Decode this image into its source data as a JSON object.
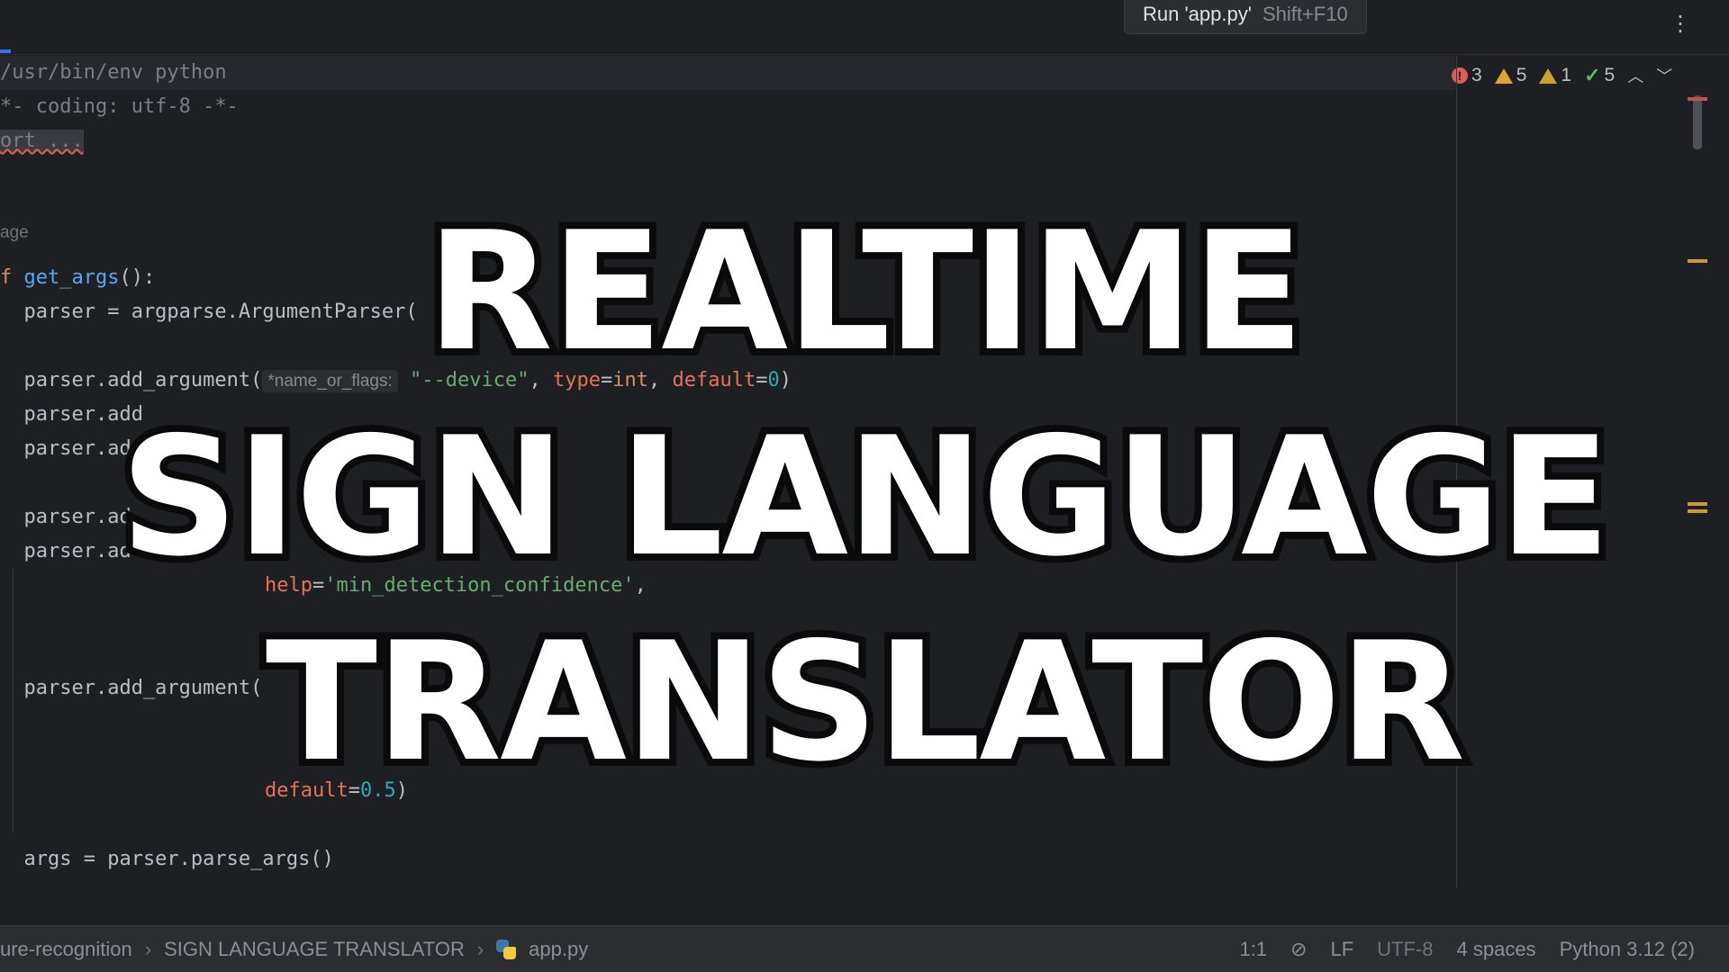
{
  "tooltip": {
    "label": "Run 'app.py'",
    "shortcut": "Shift+F10"
  },
  "inspections": {
    "errors": "3",
    "warnings": "5",
    "weak_warnings": "1",
    "ok": "5"
  },
  "editor": {
    "lines": {
      "shebang": "/usr/bin/env python",
      "coding": "*- coding: utf-8 -*-",
      "import_fold": "ort ...",
      "usage": "age",
      "def_prefix": "f ",
      "def_name": "get_args",
      "def_suffix": "():",
      "parser_line": "  parser = argparse.ArgumentParser(",
      "add_arg_device_pre": "  parser.add_argument(",
      "hint_name_or_flags": "*name_or_flags:",
      "device_str": "\"--device\"",
      "comma1": ", ",
      "type_kw": "type",
      "eq1": "=",
      "int_kw": "int",
      "comma2": ", ",
      "default_kw": "default",
      "eq2": "=",
      "zero": "0",
      "close": ")",
      "add_arg_2": "  parser.add",
      "add_arg_3": "  parser.ad",
      "add_arg_4": "  parser.ad",
      "add_arg_5": "  parser.ad",
      "help_kw": "help",
      "help_eq": "=",
      "help_str": "'min_detection_confidence'",
      "help_comma": ",",
      "add_arg_6": "  parser.add_argument(",
      "default_kw2": "default",
      "eq3": "=",
      "half": "0.5",
      "close2": ")",
      "args_line": "  args = parser.parse_args()"
    }
  },
  "statusbar": {
    "crumb1": "ure-recognition",
    "crumb2": "SIGN LANGUAGE TRANSLATOR",
    "crumb3": "app.py",
    "position": "1:1",
    "line_sep": "LF",
    "encoding": "UTF-8",
    "indent": "4 spaces",
    "interpreter": "Python 3.12 (2)"
  },
  "title": {
    "line1": "REALTIME",
    "line2": "SIGN LANGUAGE",
    "line3": "TRANSLATOR"
  }
}
